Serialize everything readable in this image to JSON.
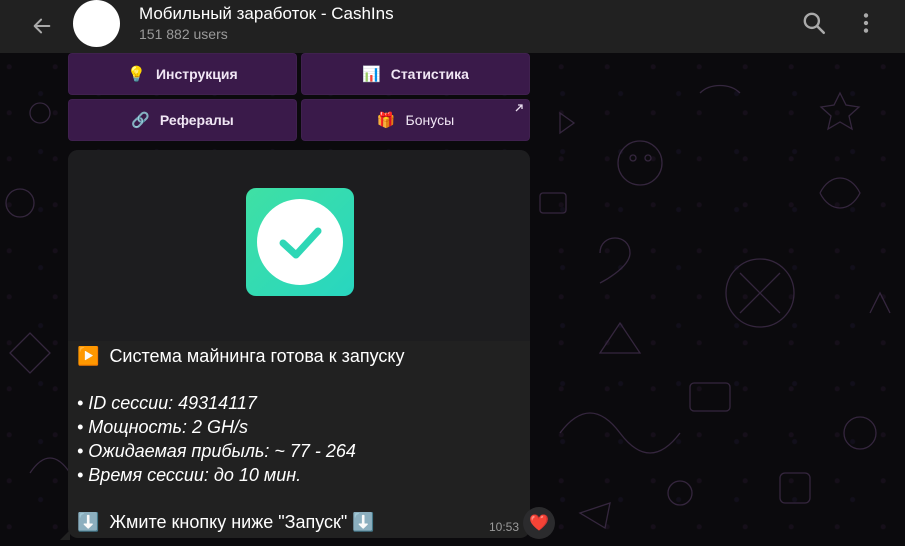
{
  "header": {
    "title": "Мобильный заработок - CashIns",
    "subtitle": "151 882 users",
    "avatar_emoji": "⚡",
    "back_icon": "arrow-left-icon",
    "search_icon": "search-icon",
    "menu_icon": "more-vertical-icon"
  },
  "keyboard": {
    "row1": [
      {
        "emoji": "💡",
        "label": "Инструкция"
      },
      {
        "emoji": "📊",
        "label": "Статистика"
      }
    ],
    "row2": [
      {
        "emoji": "🔗",
        "label": "Рефералы"
      },
      {
        "emoji": "🎁",
        "label": "Бонусы"
      }
    ]
  },
  "message": {
    "line1_emoji": "▶️",
    "line1": "Система майнинга готова к запуску",
    "bullets": [
      "• ID сессии: 49314117",
      "• Мощность: 2 GH/s",
      "• Ожидаемая прибыль: ~ 77 - 264",
      "• Время сессии: до 10 мин."
    ],
    "footer_emoji_left": "⬇️",
    "footer": "Жмите кнопку ниже \"Запуск\"",
    "footer_emoji_right": "⬇️",
    "time": "10:53",
    "reaction": "❤️"
  },
  "colors": {
    "header_bg": "#212121",
    "bubble_bg": "#212121",
    "keyboard_button_bg": "#3a1a4a",
    "check_gradient_start": "#3fe0a4",
    "check_gradient_end": "#28d6c0"
  }
}
